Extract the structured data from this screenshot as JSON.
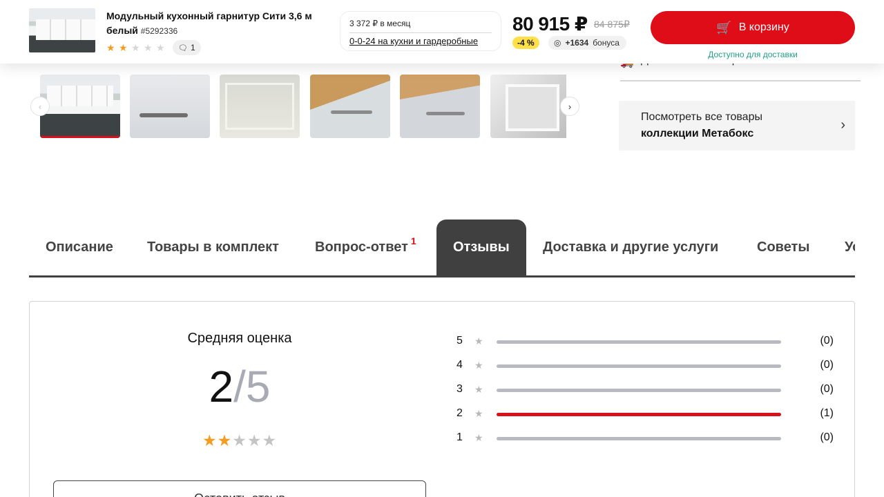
{
  "product": {
    "title": "Модульный кухонный гарнитур Сити 3,6 м белый",
    "sku": "#5292336",
    "rating_stars": 2,
    "comments_count": "1"
  },
  "credit": {
    "monthly": "3 372 ₽ в месяц",
    "link": "0-0-24 на кухни и гардеробные"
  },
  "price": {
    "current": "80 915 ₽",
    "old": "84 875₽",
    "discount": "-4 %",
    "bonus_amount": "+1634",
    "bonus_label": "бонуса"
  },
  "cart": {
    "button_label": "В корзину",
    "availability": "Доступно для доставки"
  },
  "delivery": {
    "label": "Доставка",
    "value": "завтра"
  },
  "collection": {
    "line1": "Посмотреть все товары",
    "line2": "коллекции Метабокс"
  },
  "gallery": {
    "thumbnails": [
      "kitchen-set",
      "door-handle",
      "open-cabinet",
      "wooden-countertop",
      "countertop-handle",
      "open-drawer"
    ],
    "active_index": 0
  },
  "tabs": [
    {
      "label": "Описание"
    },
    {
      "label": "Товары в комплект"
    },
    {
      "label": "Вопрос-ответ",
      "badge": "1"
    },
    {
      "label": "Отзывы",
      "active": true
    },
    {
      "label": "Доставка и другие услуги"
    },
    {
      "label": "Советы"
    },
    {
      "label": "Услуги"
    }
  ],
  "reviews": {
    "avg_title": "Средняя оценка",
    "avg_value": "2",
    "avg_max": "/5",
    "avg_stars": 2,
    "leave_button": "Оставить отзыв",
    "distribution": [
      {
        "level": "5",
        "count": "(0)",
        "fraction": 0
      },
      {
        "level": "4",
        "count": "(0)",
        "fraction": 0
      },
      {
        "level": "3",
        "count": "(0)",
        "fraction": 0
      },
      {
        "level": "2",
        "count": "(1)",
        "fraction": 1
      },
      {
        "level": "1",
        "count": "(0)",
        "fraction": 0
      }
    ]
  },
  "colors": {
    "accent_red": "#df0d17",
    "star_orange": "#f39c1f",
    "discount_yellow": "#ffe04a",
    "availability_green": "#1ea184",
    "tab_active_bg": "#404040"
  }
}
